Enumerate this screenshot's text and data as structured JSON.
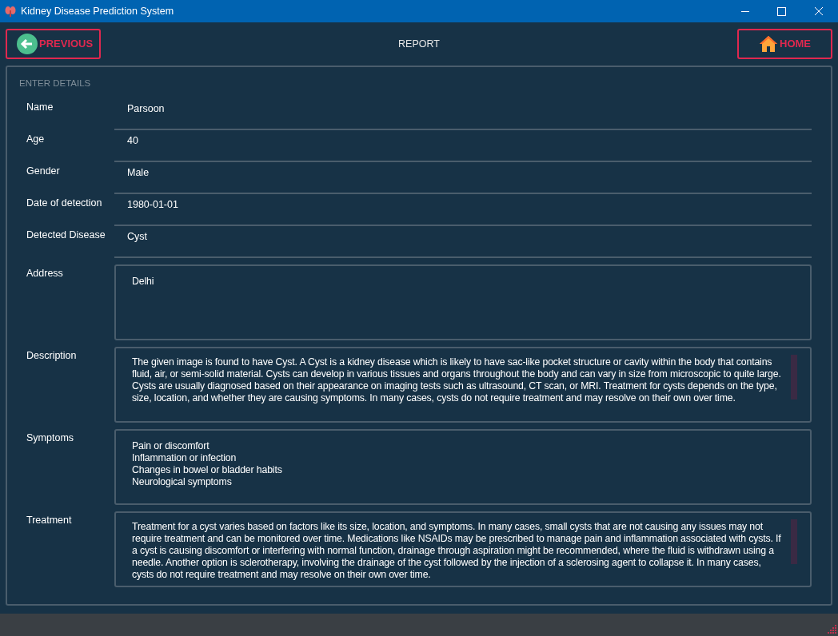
{
  "window": {
    "title": "Kidney Disease Prediction System"
  },
  "header": {
    "previous_button": "PREVIOUS",
    "title": "REPORT",
    "home_button": "HOME"
  },
  "section_title": "ENTER DETAILS",
  "fields": [
    {
      "kind": "line",
      "label": "Name",
      "value": "Parsoon"
    },
    {
      "kind": "line",
      "label": "Age",
      "value": "40"
    },
    {
      "kind": "line",
      "label": "Gender",
      "value": "Male"
    },
    {
      "kind": "line",
      "label": "Date of detection",
      "value": "1980-01-01"
    },
    {
      "kind": "line",
      "label": "Detected Disease",
      "value": "Cyst"
    },
    {
      "kind": "area",
      "label": "Address",
      "value": "Delhi"
    },
    {
      "kind": "area",
      "label": "Description",
      "value": "The given image is found to have Cyst. A Cyst is a kidney disease which is likely to have  sac-like pocket structure or cavity within the body that contains fluid, air, or semi-solid material. Cysts can develop in various tissues and organs throughout the body and can vary in size from microscopic to quite large. Cysts are usually diagnosed based on their appearance on imaging tests such as ultrasound, CT scan, or MRI. Treatment for cysts depends on the type, size, location, and whether they are causing symptoms. In many cases, cysts do not require treatment and may resolve on their own over time."
    },
    {
      "kind": "area",
      "label": "Symptoms",
      "value": "Pain or discomfort\nInflammation or infection\nChanges in bowel or bladder habits\nNeurological symptoms"
    },
    {
      "kind": "area",
      "label": "Treatment",
      "value": "Treatment for a cyst varies based on factors like its size, location, and symptoms. In many cases, small cysts that are not causing any issues may not require treatment and can be monitored over time. Medications like NSAIDs may be prescribed to manage pain and inflammation associated with cysts. If a cyst is causing discomfort or interfering with normal function, drainage through aspiration might be recommended, where the fluid is withdrawn using a needle. Another option is sclerotherapy, involving the drainage of the cyst followed by the injection of a sclerosing agent to collapse it. In many cases, cysts do not require treatment and may resolve on their own over time."
    }
  ]
}
